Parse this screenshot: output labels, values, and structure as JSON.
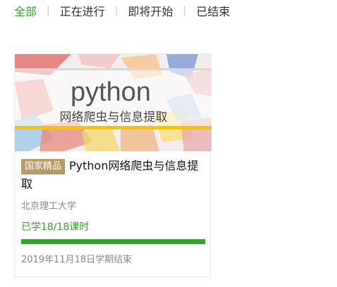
{
  "tabs": [
    {
      "label": "全部"
    },
    {
      "label": "正在进行"
    },
    {
      "label": "即将开始"
    },
    {
      "label": "已结束"
    }
  ],
  "course": {
    "cover": {
      "logo_text": "python",
      "subtitle": "网络爬虫与信息提取"
    },
    "badge": "国家精品",
    "title": "Python网络爬虫与信息提取",
    "university": "北京理工大学",
    "progress_text": "已学18/18课时",
    "progress_fraction": 1.0,
    "end_date": "2019年11月18日学期结束"
  },
  "colors": {
    "accent": "#39a22e",
    "badge": "#b79a66"
  }
}
